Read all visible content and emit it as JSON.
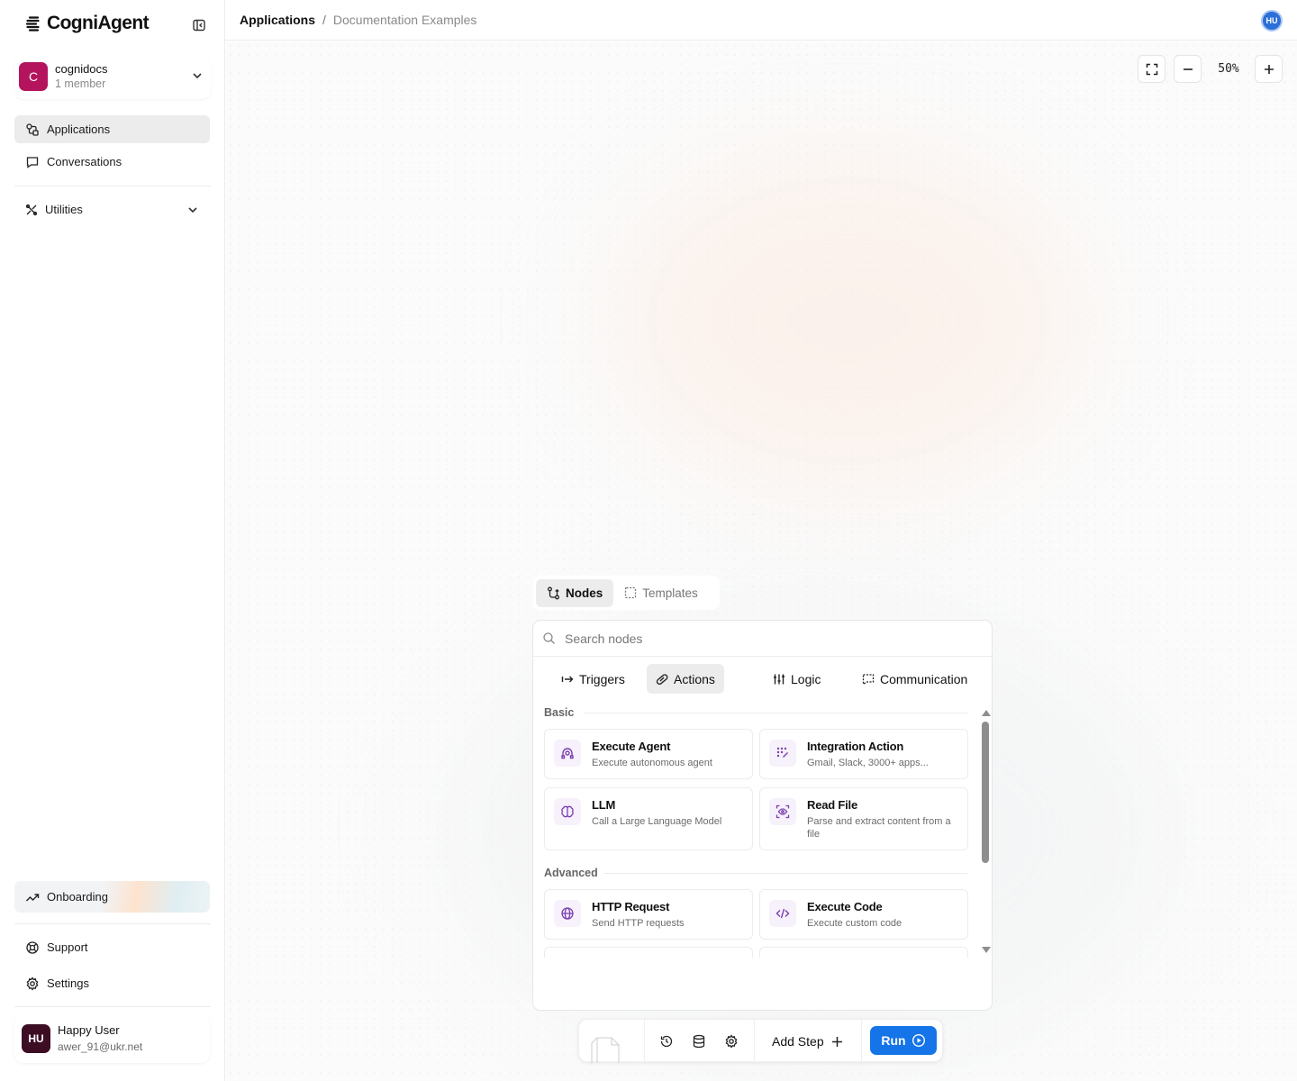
{
  "app": {
    "logo_text": "CogniAgent"
  },
  "org": {
    "initial": "C",
    "name": "cognidocs",
    "members": "1 member"
  },
  "nav": {
    "applications": "Applications",
    "conversations": "Conversations",
    "utilities": "Utilities",
    "onboarding": "Onboarding",
    "support": "Support",
    "settings": "Settings"
  },
  "user": {
    "initials": "HU",
    "name": "Happy User",
    "email": "awer_91@ukr.net"
  },
  "breadcrumb": {
    "root": "Applications",
    "separator": "/",
    "current": "Documentation Examples"
  },
  "top_avatar": "HU",
  "zoom": {
    "level": "50%"
  },
  "view_tabs": {
    "nodes": "Nodes",
    "templates": "Templates",
    "active": "Nodes"
  },
  "search": {
    "placeholder": "Search nodes",
    "value": ""
  },
  "categories": {
    "triggers": "Triggers",
    "actions": "Actions",
    "logic": "Logic",
    "communication": "Communication",
    "active": "Actions"
  },
  "sections": {
    "basic": {
      "label": "Basic",
      "nodes": [
        {
          "title": "Execute Agent",
          "desc": "Execute autonomous agent",
          "icon": "agent-icon"
        },
        {
          "title": "Integration Action",
          "desc": "Gmail, Slack, 3000+ apps...",
          "icon": "integration-icon"
        },
        {
          "title": "LLM",
          "desc": "Call a Large Language Model",
          "icon": "brain-icon"
        },
        {
          "title": "Read File",
          "desc": "Parse and extract content from a file",
          "icon": "file-scan-icon"
        }
      ]
    },
    "advanced": {
      "label": "Advanced",
      "nodes": [
        {
          "title": "HTTP Request",
          "desc": "Send HTTP requests",
          "icon": "globe-icon"
        },
        {
          "title": "Execute Code",
          "desc": "Execute custom code",
          "icon": "code-icon"
        }
      ]
    }
  },
  "toolbar": {
    "add_step": "Add Step",
    "run": "Run"
  },
  "colors": {
    "run_button": "#1474e8",
    "org_avatar": "#b4145d",
    "user_avatar": "#3d0e23",
    "node_icon": "#7c3fb0",
    "top_avatar": "#2c6fd8"
  }
}
